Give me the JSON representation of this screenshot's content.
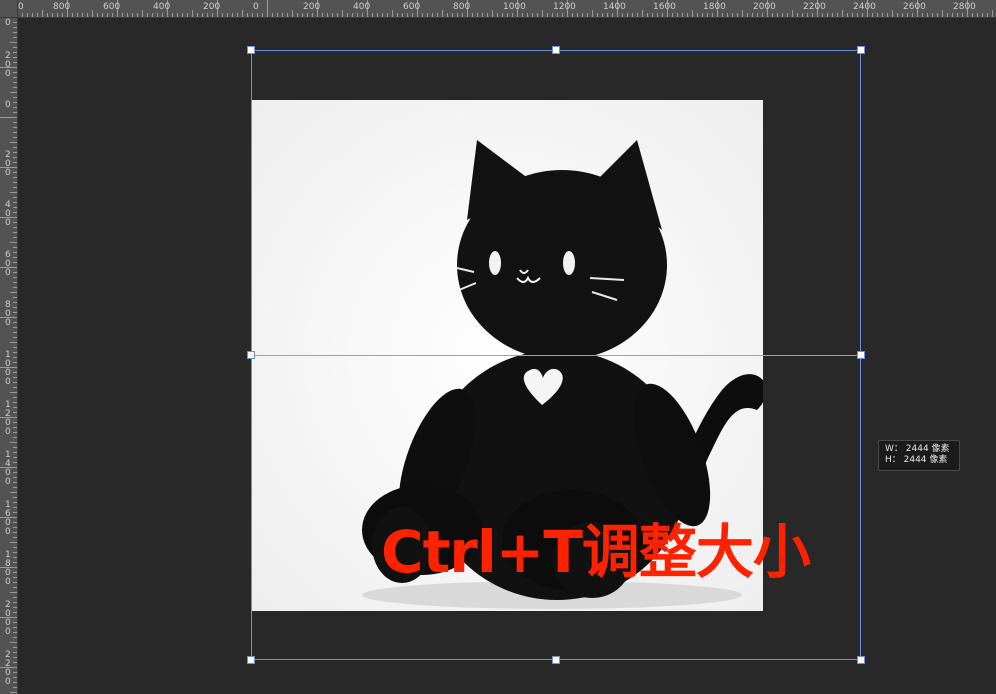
{
  "ruler_top": {
    "labels": [
      "0",
      "800",
      "600",
      "400",
      "200",
      "0",
      "200",
      "400",
      "600",
      "800",
      "1000",
      "1200",
      "1400",
      "1600",
      "1800",
      "2000",
      "2200",
      "2400",
      "2600",
      "2800"
    ]
  },
  "ruler_left": {
    "labels": [
      "0",
      "200",
      "0",
      "200",
      "400",
      "600",
      "800",
      "1000",
      "1200",
      "1400",
      "1600",
      "1800",
      "2000",
      "2200"
    ]
  },
  "overlay": {
    "text": "Ctrl+T调整大小"
  },
  "size_tooltip": {
    "width_line": "W： 2444 像素",
    "height_line": "H： 2444 像素"
  },
  "colors": {
    "overlay_text": "#ff2200",
    "bbox": "#6e8ede",
    "guide": "#d47be8",
    "canvas": "#282828"
  }
}
